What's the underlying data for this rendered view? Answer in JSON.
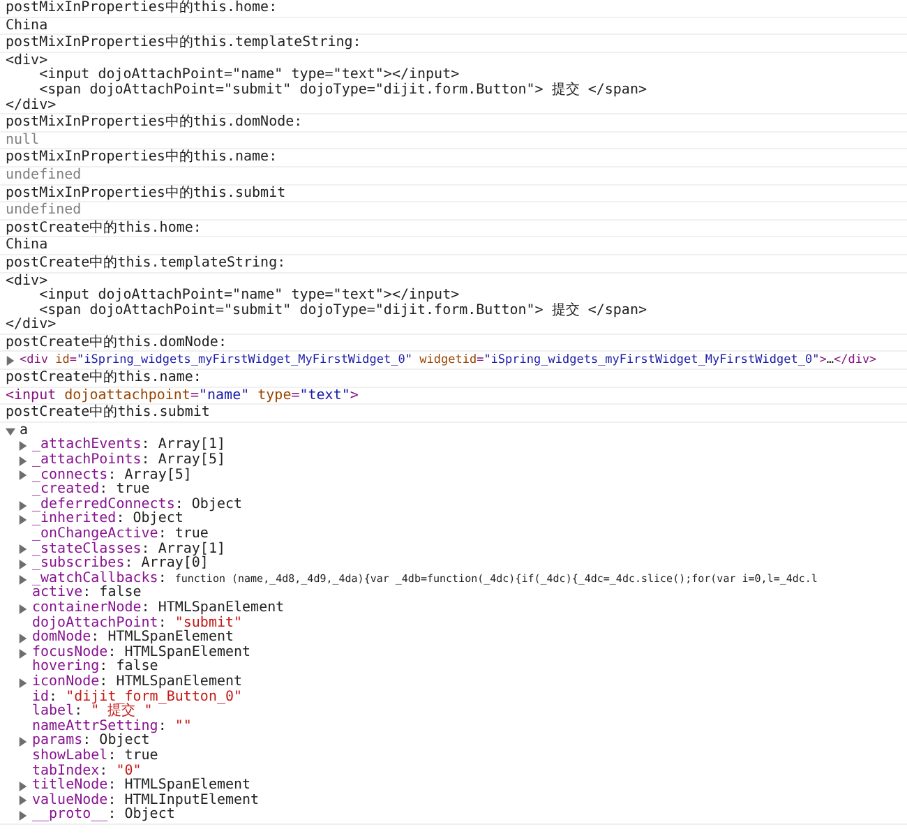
{
  "console": {
    "messages": [
      {
        "kind": "log",
        "text": "postMixInProperties中的this.home:"
      },
      {
        "kind": "log",
        "text": "China"
      },
      {
        "kind": "log",
        "text": "postMixInProperties中的this.templateString:"
      },
      {
        "kind": "code",
        "lines": [
          "<div>",
          "    <input dojoAttachPoint=\"name\" type=\"text\"></input>",
          "    <span dojoAttachPoint=\"submit\" dojoType=\"dijit.form.Button\"> 提交 </span>",
          "</div>"
        ]
      },
      {
        "kind": "log",
        "text": "postMixInProperties中的this.domNode:"
      },
      {
        "kind": "muted",
        "text": "null"
      },
      {
        "kind": "log",
        "text": "postMixInProperties中的this.name:"
      },
      {
        "kind": "muted",
        "text": "undefined"
      },
      {
        "kind": "log",
        "text": "postMixInProperties中的this.submit"
      },
      {
        "kind": "muted",
        "text": "undefined"
      },
      {
        "kind": "log",
        "text": "postCreate中的this.home:"
      },
      {
        "kind": "log",
        "text": "China"
      },
      {
        "kind": "log",
        "text": "postCreate中的this.templateString:"
      },
      {
        "kind": "code",
        "lines": [
          "<div>",
          "    <input dojoAttachPoint=\"name\" type=\"text\"></input>",
          "    <span dojoAttachPoint=\"submit\" dojoType=\"dijit.form.Button\"> 提交 </span>",
          "</div>"
        ]
      },
      {
        "kind": "log",
        "text": "postCreate中的this.domNode:"
      },
      {
        "kind": "element",
        "expanded": false,
        "tokens": [
          {
            "kind": "tag",
            "text": "<div"
          },
          {
            "kind": "attr",
            "text": " id"
          },
          {
            "kind": "tag",
            "text": "="
          },
          {
            "kind": "value",
            "text": "\"iSpring_widgets_myFirstWidget_MyFirstWidget_0\""
          },
          {
            "kind": "attr",
            "text": " widgetid"
          },
          {
            "kind": "tag",
            "text": "="
          },
          {
            "kind": "value",
            "text": "\"iSpring_widgets_myFirstWidget_MyFirstWidget_0\""
          },
          {
            "kind": "tag",
            "text": ">"
          },
          {
            "kind": "plain",
            "text": "…"
          },
          {
            "kind": "tag",
            "text": "</div>"
          }
        ]
      },
      {
        "kind": "log",
        "text": "postCreate中的this.name:"
      },
      {
        "kind": "tag",
        "tokens": [
          {
            "kind": "tag",
            "text": "<input"
          },
          {
            "kind": "attr",
            "text": " dojoattachpoint"
          },
          {
            "kind": "tag",
            "text": "="
          },
          {
            "kind": "value",
            "text": "\"name\""
          },
          {
            "kind": "attr",
            "text": " type"
          },
          {
            "kind": "tag",
            "text": "="
          },
          {
            "kind": "value",
            "text": "\"text\""
          },
          {
            "kind": "tag",
            "text": ">"
          }
        ]
      },
      {
        "kind": "log",
        "text": "postCreate中的this.submit"
      },
      {
        "kind": "object",
        "expanded": true,
        "text": "a",
        "properties": [
          {
            "kind": "plain",
            "expanded": false,
            "key": "_attachEvents",
            "sep": ": ",
            "value": "Array[1]"
          },
          {
            "kind": "plain",
            "expanded": false,
            "key": "_attachPoints",
            "sep": ": ",
            "value": "Array[5]"
          },
          {
            "kind": "plain",
            "expanded": false,
            "key": "_connects",
            "sep": ": ",
            "value": "Array[5]"
          },
          {
            "kind": "plain",
            "key": "_created",
            "sep": ": ",
            "value": "true"
          },
          {
            "kind": "plain",
            "expanded": false,
            "key": "_deferredConnects",
            "sep": ": ",
            "value": "Object"
          },
          {
            "kind": "plain",
            "expanded": false,
            "key": "_inherited",
            "sep": ": ",
            "value": "Object"
          },
          {
            "kind": "plain",
            "key": "_onChangeActive",
            "sep": ": ",
            "value": "true"
          },
          {
            "kind": "plain",
            "expanded": false,
            "key": "_stateClasses",
            "sep": ": ",
            "value": "Array[1]"
          },
          {
            "kind": "plain",
            "expanded": false,
            "key": "_subscribes",
            "sep": ": ",
            "value": "Array[0]"
          },
          {
            "kind": "function",
            "expanded": false,
            "key": "_watchCallbacks",
            "sep": ": ",
            "value": "function (name,_4d8,_4d9,_4da){var _4db=function(_4dc){if(_4dc){_4dc=_4dc.slice();for(var i=0,l=_4dc.l"
          },
          {
            "kind": "plain",
            "key": "active",
            "sep": ": ",
            "value": "false"
          },
          {
            "kind": "plain",
            "expanded": false,
            "key": "containerNode",
            "sep": ": ",
            "value": "HTMLSpanElement"
          },
          {
            "kind": "string",
            "key": "dojoAttachPoint",
            "sep": ": ",
            "value": "\"submit\""
          },
          {
            "kind": "plain",
            "expanded": false,
            "key": "domNode",
            "sep": ": ",
            "value": "HTMLSpanElement"
          },
          {
            "kind": "plain",
            "expanded": false,
            "key": "focusNode",
            "sep": ": ",
            "value": "HTMLSpanElement"
          },
          {
            "kind": "plain",
            "key": "hovering",
            "sep": ": ",
            "value": "false"
          },
          {
            "kind": "plain",
            "expanded": false,
            "key": "iconNode",
            "sep": ": ",
            "value": "HTMLSpanElement"
          },
          {
            "kind": "string",
            "key": "id",
            "sep": ": ",
            "value": "\"dijit_form_Button_0\""
          },
          {
            "kind": "string",
            "key": "label",
            "sep": ": ",
            "value": "\" 提交 \""
          },
          {
            "kind": "string",
            "key": "nameAttrSetting",
            "sep": ": ",
            "value": "\"\""
          },
          {
            "kind": "plain",
            "expanded": false,
            "key": "params",
            "sep": ": ",
            "value": "Object"
          },
          {
            "kind": "plain",
            "key": "showLabel",
            "sep": ": ",
            "value": "true"
          },
          {
            "kind": "string",
            "key": "tabIndex",
            "sep": ": ",
            "value": "\"0\""
          },
          {
            "kind": "plain",
            "expanded": false,
            "key": "titleNode",
            "sep": ": ",
            "value": "HTMLSpanElement"
          },
          {
            "kind": "plain",
            "expanded": false,
            "key": "valueNode",
            "sep": ": ",
            "value": "HTMLInputElement"
          },
          {
            "kind": "plain",
            "expanded": false,
            "key": "__proto__",
            "sep": ": ",
            "value": "Object"
          }
        ]
      }
    ]
  }
}
